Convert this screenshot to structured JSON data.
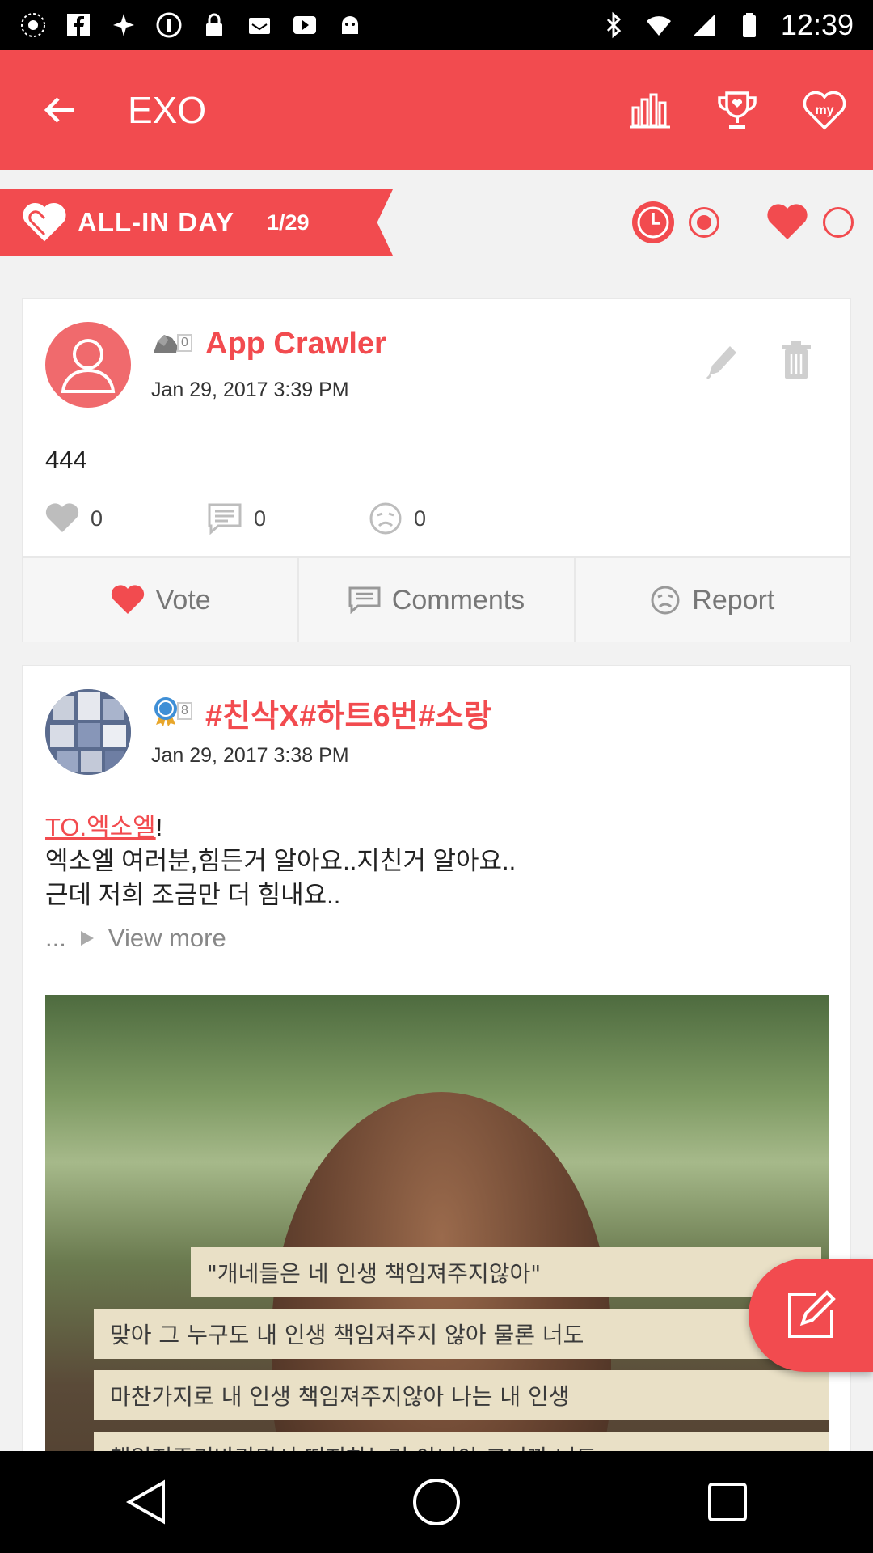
{
  "status_bar": {
    "time": "12:39"
  },
  "app_bar": {
    "title": "EXO"
  },
  "banner": {
    "label": "ALL-IN DAY",
    "count": "1/29"
  },
  "posts": [
    {
      "author": "App Crawler",
      "badge_level": "0",
      "date": "Jan 29, 2017 3:39 PM",
      "text": "444",
      "votes": "0",
      "comments": "0",
      "reports": "0"
    },
    {
      "author": "#친삭X#하트6번#소랑",
      "badge_level": "8",
      "date": "Jan 29, 2017 3:38 PM",
      "link_text": "TO.엑소엘",
      "text_after_link": "!",
      "line2": "엑소엘 여러분,힘든거 알아요..지친거 알아요..",
      "line3": "근데 저희 조금만 더 힘내요..",
      "ellipsis": "...",
      "view_more": "View more",
      "image_text": [
        "\"개네들은 네 인생 책임져주지않아\"",
        "맞아 그 누구도 내 인생 책임져주지 않아 물론 너도",
        "마찬가지로 내 인생 책임져주지않아 나는 내 인생",
        "책임져주기바라면서 떠지하는거 아니야 그니까 너도"
      ]
    }
  ],
  "actions": {
    "vote": "Vote",
    "comments": "Comments",
    "report": "Report"
  },
  "colors": {
    "accent": "#f24b4f",
    "gray": "#777777"
  }
}
